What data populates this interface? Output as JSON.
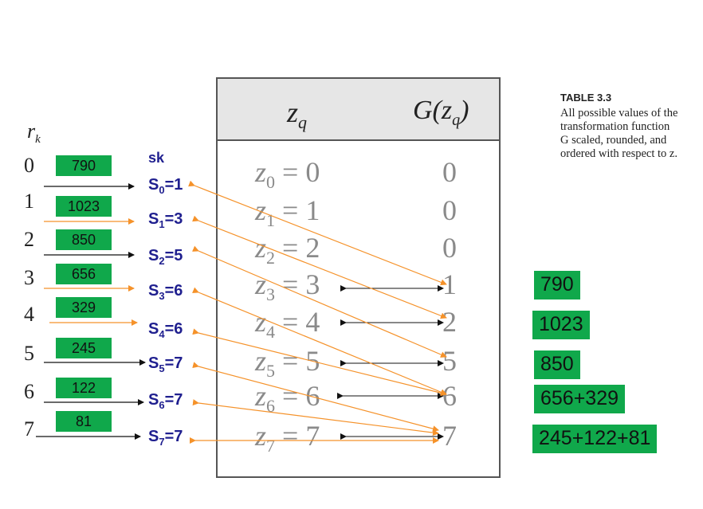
{
  "labels": {
    "rk_symbol": "r",
    "rk_sub": "k",
    "sk_header": "sk"
  },
  "table": {
    "header_zq": "z",
    "header_zq_sub": "q",
    "header_g": "G(z",
    "header_g_sub": "q",
    "header_g_close": ")",
    "rows": [
      {
        "z": "z",
        "sub": "0",
        "eq": " = 0",
        "g": "0"
      },
      {
        "z": "z",
        "sub": "1",
        "eq": " = 1",
        "g": "0"
      },
      {
        "z": "z",
        "sub": "2",
        "eq": " = 2",
        "g": "0"
      },
      {
        "z": "z",
        "sub": "3",
        "eq": " = 3",
        "g": "1"
      },
      {
        "z": "z",
        "sub": "4",
        "eq": " = 4",
        "g": "2"
      },
      {
        "z": "z",
        "sub": "5",
        "eq": " = 5",
        "g": "5"
      },
      {
        "z": "z",
        "sub": "6",
        "eq": " = 6",
        "g": "6"
      },
      {
        "z": "z",
        "sub": "7",
        "eq": " = 7",
        "g": "7"
      }
    ]
  },
  "rk_values": [
    "0",
    "1",
    "2",
    "3",
    "4",
    "5",
    "6",
    "7"
  ],
  "counts": [
    "790",
    "1023",
    "850",
    "656",
    "329",
    "245",
    "122",
    "81"
  ],
  "s_values": [
    {
      "s": "S",
      "sub": "0",
      "eq": "=1"
    },
    {
      "s": "S",
      "sub": "1",
      "eq": "=3"
    },
    {
      "s": "S",
      "sub": "2",
      "eq": "=5"
    },
    {
      "s": "S",
      "sub": "3",
      "eq": "=6"
    },
    {
      "s": "S",
      "sub": "4",
      "eq": "=6"
    },
    {
      "s": "S",
      "sub": "5",
      "eq": "=7"
    },
    {
      "s": "S",
      "sub": "6",
      "eq": "=7"
    },
    {
      "s": "S",
      "sub": "7",
      "eq": "=7"
    }
  ],
  "caption": {
    "title": "TABLE 3.3",
    "text": "All possible values of the transformation function G scaled, rounded, and ordered with respect to z."
  },
  "result_boxes": [
    "790",
    "1023",
    "850",
    "656+329",
    "245+122+81"
  ],
  "colors": {
    "green": "#10a84b",
    "navy": "#1f1f8f",
    "orange_arrow": "#f5922a",
    "black_arrow": "#111111"
  }
}
